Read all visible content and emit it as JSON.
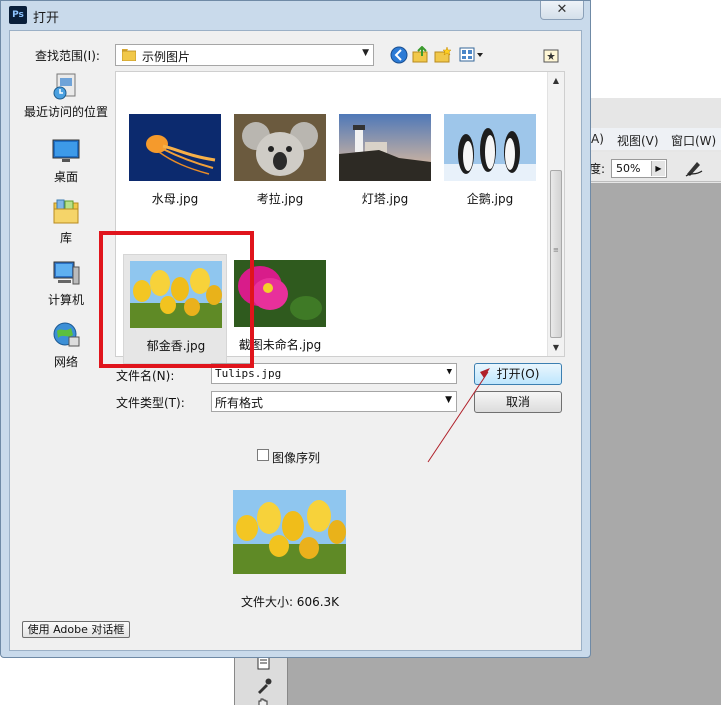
{
  "background_app": {
    "menu_items": [
      "A)",
      "视图(V)",
      "窗口(W)"
    ],
    "zoom_value": "50%",
    "zoom_label_fragment": "度:"
  },
  "dialog": {
    "title": "打开",
    "app_icon_label": "Ps",
    "close_glyph": "✕"
  },
  "lookin": {
    "label": "查找范围(I):",
    "value": "示例图片"
  },
  "places": [
    {
      "label": "最近访问的位置",
      "icon": "recent-places-icon"
    },
    {
      "label": "桌面",
      "icon": "desktop-icon"
    },
    {
      "label": "库",
      "icon": "libraries-icon"
    },
    {
      "label": "计算机",
      "icon": "computer-icon"
    },
    {
      "label": "网络",
      "icon": "network-icon"
    }
  ],
  "files": [
    {
      "label": "水母.jpg"
    },
    {
      "label": "考拉.jpg"
    },
    {
      "label": "灯塔.jpg"
    },
    {
      "label": "企鹅.jpg"
    },
    {
      "label": "郁金香.jpg"
    },
    {
      "label": "截图未命名.jpg"
    }
  ],
  "filename": {
    "label": "文件名(N):",
    "value": "Tulips.jpg"
  },
  "filetype": {
    "label": "文件类型(T):",
    "value": "所有格式"
  },
  "buttons": {
    "open": "打开(O)",
    "cancel": "取消",
    "adobe_dialog": "使用 Adobe 对话框"
  },
  "image_sequence": {
    "label": "图像序列",
    "checked": false
  },
  "preview": {
    "filesize": "文件大小: 606.3K"
  },
  "colors": {
    "highlight_box": "#e0141c",
    "annotation_arrow": "#b0202a",
    "dialog_frame": "#c9daeb"
  }
}
